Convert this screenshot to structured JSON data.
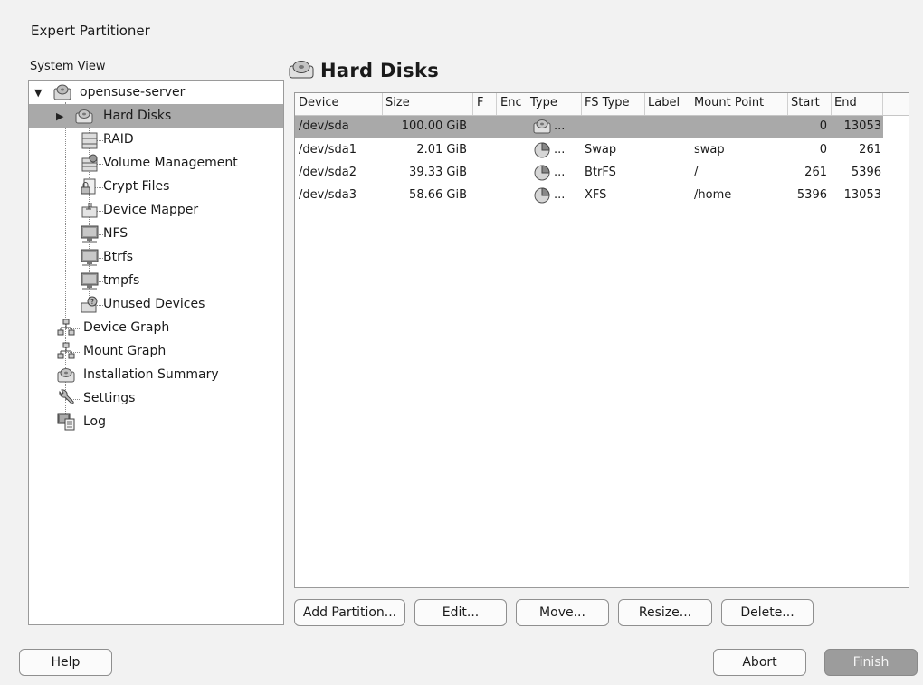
{
  "window": {
    "title": "Expert Partitioner"
  },
  "tree": {
    "label": "System View",
    "items": [
      {
        "label": "opensuse-server",
        "icon": "server-disk-icon"
      },
      {
        "label": "Hard Disks",
        "icon": "hard-disk-icon"
      },
      {
        "label": "RAID",
        "icon": "raid-icon"
      },
      {
        "label": "Volume Management",
        "icon": "volume-management-icon"
      },
      {
        "label": "Crypt Files",
        "icon": "crypt-files-icon"
      },
      {
        "label": "Device Mapper",
        "icon": "device-mapper-icon"
      },
      {
        "label": "NFS",
        "icon": "nfs-icon"
      },
      {
        "label": "Btrfs",
        "icon": "btrfs-icon"
      },
      {
        "label": "tmpfs",
        "icon": "tmpfs-icon"
      },
      {
        "label": "Unused Devices",
        "icon": "unused-devices-icon"
      },
      {
        "label": "Device Graph",
        "icon": "device-graph-icon"
      },
      {
        "label": "Mount Graph",
        "icon": "mount-graph-icon"
      },
      {
        "label": "Installation Summary",
        "icon": "installation-summary-icon"
      },
      {
        "label": "Settings",
        "icon": "settings-icon"
      },
      {
        "label": "Log",
        "icon": "log-icon"
      }
    ]
  },
  "pane": {
    "title": "Hard Disks"
  },
  "table": {
    "columns": [
      "Device",
      "Size",
      "F",
      "Enc",
      "Type",
      "FS Type",
      "Label",
      "Mount Point",
      "Start",
      "End"
    ],
    "rows": [
      {
        "device": "/dev/sda",
        "size": "100.00 GiB",
        "f": "",
        "enc": "",
        "type": "...",
        "fs_type": "",
        "label": "",
        "mount": "",
        "start": "0",
        "end": "13053"
      },
      {
        "device": "/dev/sda1",
        "size": "2.01 GiB",
        "f": "",
        "enc": "",
        "type": "...",
        "fs_type": "Swap",
        "label": "",
        "mount": "swap",
        "start": "0",
        "end": "261"
      },
      {
        "device": "/dev/sda2",
        "size": "39.33 GiB",
        "f": "",
        "enc": "",
        "type": "...",
        "fs_type": "BtrFS",
        "label": "",
        "mount": "/",
        "start": "261",
        "end": "5396"
      },
      {
        "device": "/dev/sda3",
        "size": "58.66 GiB",
        "f": "",
        "enc": "",
        "type": "...",
        "fs_type": "XFS",
        "label": "",
        "mount": "/home",
        "start": "5396",
        "end": "13053"
      }
    ]
  },
  "actions": {
    "add_partition": "Add Partition...",
    "edit": "Edit...",
    "move": "Move...",
    "resize": "Resize...",
    "delete": "Delete..."
  },
  "footer": {
    "help": "Help",
    "abort": "Abort",
    "finish": "Finish"
  },
  "colors": {
    "selection": "#a9a9a9",
    "background": "#f2f2f2",
    "finish_button": "#9c9c9c"
  }
}
